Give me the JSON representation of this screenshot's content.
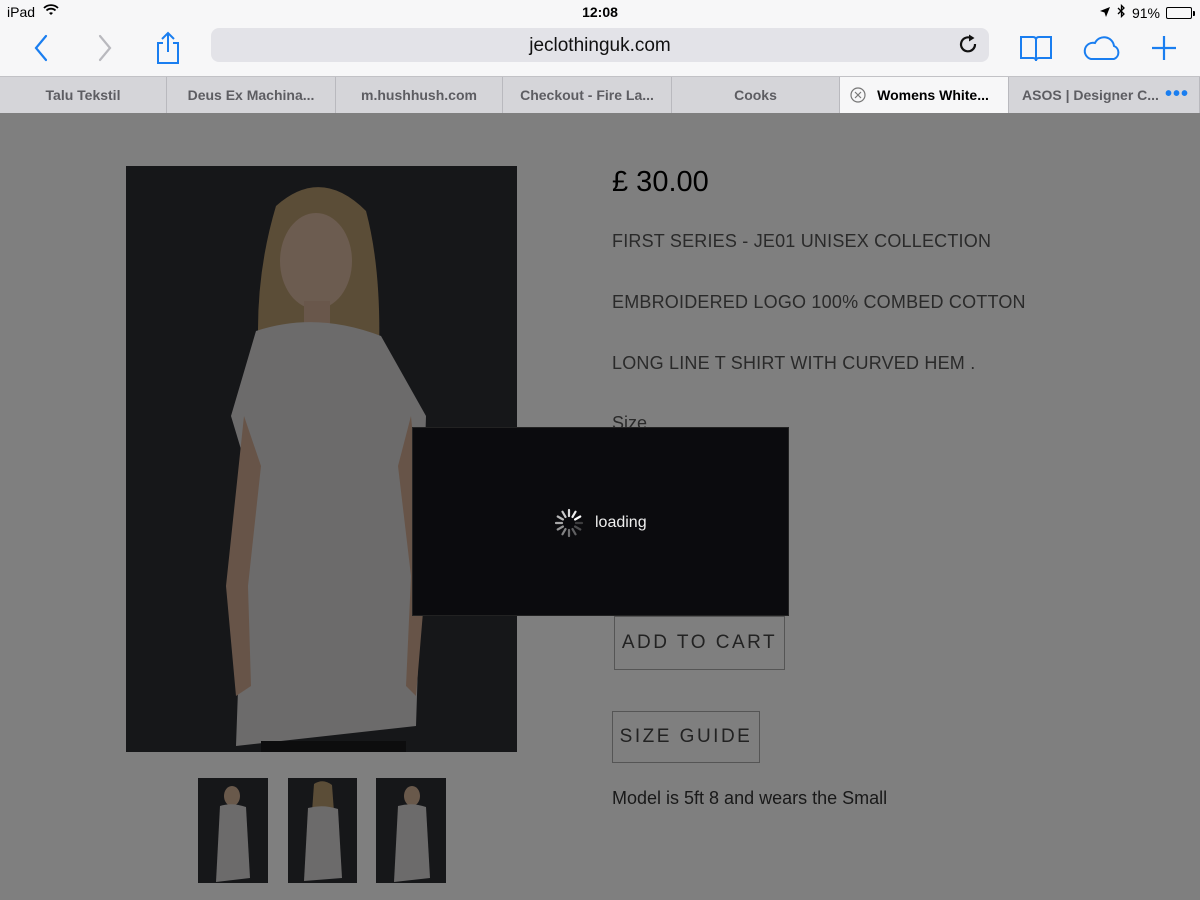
{
  "status_bar": {
    "device": "iPad",
    "time": "12:08",
    "battery": "91%",
    "battery_level": 0.91
  },
  "toolbar": {
    "url": "jeclothinguk.com"
  },
  "tabs": [
    {
      "label": "Talu Tekstil"
    },
    {
      "label": "Deus Ex Machina..."
    },
    {
      "label": "m.hushhush.com"
    },
    {
      "label": "Checkout - Fire La..."
    },
    {
      "label": "Cooks"
    },
    {
      "label": "Womens White..."
    },
    {
      "label": "ASOS | Designer C..."
    }
  ],
  "product": {
    "price": "£ 30.00",
    "descriptions": [
      "FIRST SERIES - JE01 UNISEX COLLECTION",
      "EMBROIDERED LOGO 100% COMBED COTTON",
      "LONG LINE T SHIRT WITH CURVED HEM ."
    ],
    "size_label": "Size",
    "add_to_cart_label": "ADD TO CART",
    "size_guide_label": "SIZE GUIDE",
    "model_note": "Model is 5ft 8 and wears the Small"
  },
  "loading": {
    "text": "loading"
  },
  "colors": {
    "accent": "#1a7ef0",
    "overlay": "#000000",
    "loading_bg": "#0b0b0e"
  },
  "icons": {
    "back": "chevron-left-icon",
    "forward": "chevron-right-icon",
    "share": "share-icon",
    "reload": "reload-icon",
    "bookmarks": "book-icon",
    "icloud": "cloud-icon",
    "new_tab": "plus-icon",
    "tab_close": "close-circle-icon",
    "more": "more-icon"
  }
}
